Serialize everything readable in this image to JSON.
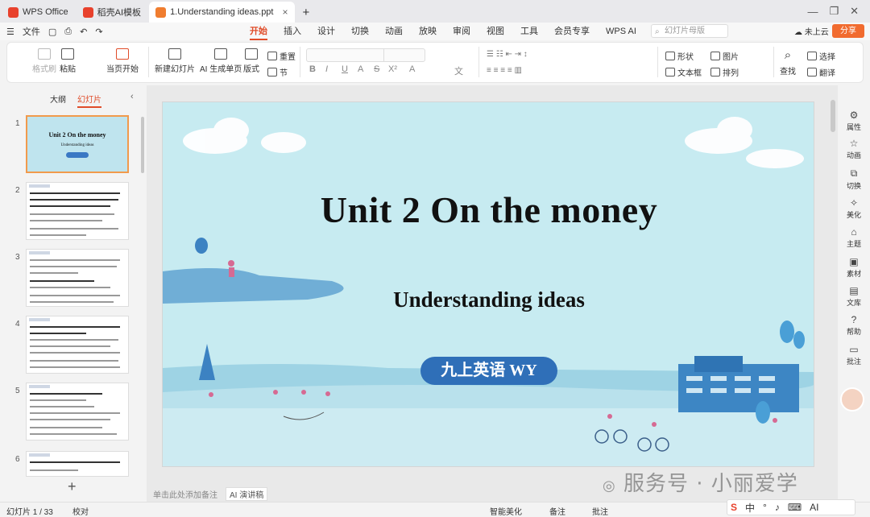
{
  "tabs": [
    {
      "label": "WPS Office",
      "color": "#e8412c"
    },
    {
      "label": "稻壳AI模板",
      "color": "#e8412c"
    },
    {
      "label": "1.Understanding ideas.ppt",
      "color": "#f07d2f"
    }
  ],
  "menu": {
    "file": "文件",
    "tabs": [
      "开始",
      "插入",
      "设计",
      "切换",
      "动画",
      "放映",
      "审阅",
      "视图",
      "工具",
      "会员专享",
      "WPS AI"
    ],
    "active": "开始",
    "search_placeholder": "幻灯片母版",
    "cloud": "未上云",
    "share": "分享"
  },
  "ribbon": {
    "format_painter": "格式刷",
    "paste": "粘贴",
    "play_from_current": "当页开始",
    "new_slide": "新建幻灯片",
    "ai_single": "AI 生成单页",
    "layout": "版式",
    "reset": "重置",
    "section": "节",
    "shape": "形状",
    "picture": "图片",
    "textbox": "文本框",
    "arrange": "排列",
    "find": "查找",
    "select": "选择",
    "translate": "翻译",
    "format_buttons": [
      "B",
      "I",
      "U",
      "A",
      "S",
      "X²",
      "A",
      "文"
    ]
  },
  "panel": {
    "outline": "大纲",
    "slides": "幻灯片"
  },
  "thumbnails": [
    {
      "num": "1",
      "title": "Unit 2 On the money",
      "subtitle": "Understanding ideas"
    },
    {
      "num": "2"
    },
    {
      "num": "3"
    },
    {
      "num": "4"
    },
    {
      "num": "5"
    },
    {
      "num": "6"
    }
  ],
  "slide": {
    "title": "Unit 2 On the money",
    "subtitle": "Understanding ideas",
    "badge": "九上英语 WY"
  },
  "notes": {
    "placeholder": "单击此处添加备注",
    "ai": "AI 演讲稿"
  },
  "rightbar": [
    "属性",
    "动画",
    "切换",
    "美化",
    "主题",
    "素材",
    "文库",
    "帮助",
    "批注"
  ],
  "status": {
    "slide_count": "幻灯片 1 / 33",
    "proofread": "校对",
    "smart": "智能美化",
    "notes": "备注",
    "comments": "批注"
  },
  "watermark": "服务号 · 小丽爱学",
  "ime": [
    "S",
    "中",
    "AI"
  ]
}
